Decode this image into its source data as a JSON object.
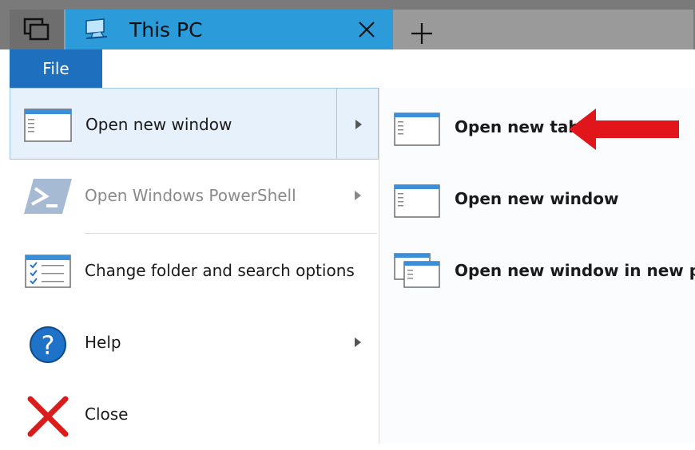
{
  "titlebar": {
    "tab_title": "This PC",
    "icons": [
      "task-view-icon",
      "this-pc-icon",
      "close-icon",
      "plus-icon"
    ]
  },
  "ribbon": {
    "file_label": "File"
  },
  "menu": {
    "items": [
      {
        "label": "Open new window",
        "icon": "window-icon",
        "has_submenu": true,
        "state": "highlighted"
      },
      {
        "label": "Open Windows PowerShell",
        "icon": "powershell-icon",
        "has_submenu": true,
        "state": "disabled"
      },
      {
        "label": "Change folder and search options",
        "icon": "folder-options-icon",
        "has_submenu": false,
        "state": "normal"
      },
      {
        "label": "Help",
        "icon": "help-icon",
        "has_submenu": true,
        "state": "normal"
      },
      {
        "label": "Close",
        "icon": "close-red-icon",
        "has_submenu": false,
        "state": "normal"
      }
    ]
  },
  "submenu": {
    "items": [
      {
        "label": "Open new tab",
        "icon": "window-icon"
      },
      {
        "label": "Open new window",
        "icon": "window-icon"
      },
      {
        "label": "Open new window in new pr",
        "icon": "windows-stack-icon"
      }
    ]
  },
  "annotation": {
    "icon": "red-arrow-icon",
    "color": "#e0161a"
  },
  "colors": {
    "tab_accent": "#2b9bd9",
    "file_tab": "#1f6fbf",
    "highlight": "#e6f1fb"
  }
}
